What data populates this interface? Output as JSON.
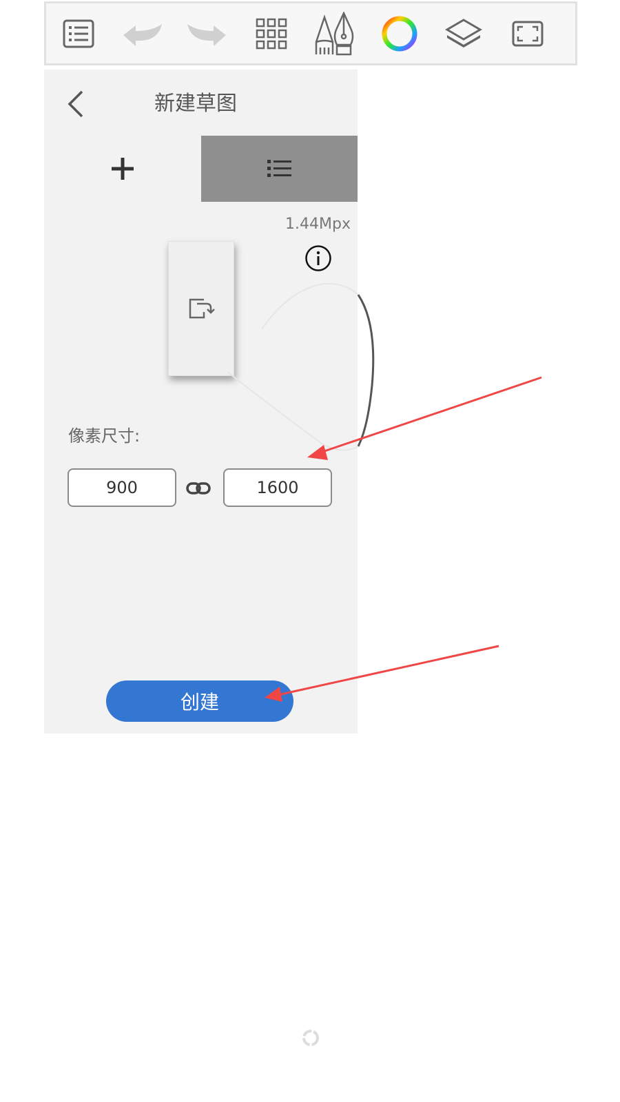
{
  "toolbar": {
    "icons": [
      "list-icon",
      "undo-icon",
      "redo-icon",
      "grid-icon",
      "pencil-pen-icon",
      "color-wheel-icon",
      "layers-icon",
      "fullscreen-icon"
    ]
  },
  "panel": {
    "title": "新建草图",
    "megapixels": "1.44Mpx",
    "size_label": "像素尺寸:",
    "width_value": "900",
    "height_value": "1600",
    "create_label": "创建"
  },
  "colors": {
    "accent": "#3477d3",
    "annotation_arrow": "#f04646",
    "panel_bg": "#f2f2f2",
    "tab_selected_bg": "#8f8f8f"
  }
}
